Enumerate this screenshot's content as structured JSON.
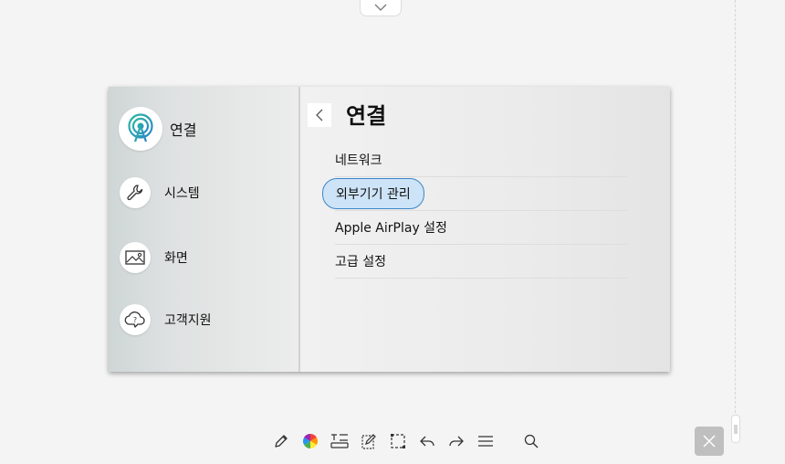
{
  "sidebar": {
    "items": [
      {
        "label": "연결",
        "icon": "antenna-icon",
        "active": true
      },
      {
        "label": "시스템",
        "icon": "wrench-icon",
        "active": false
      },
      {
        "label": "화면",
        "icon": "image-icon",
        "active": false
      },
      {
        "label": "고객지원",
        "icon": "cloud-help-icon",
        "active": false
      }
    ]
  },
  "main": {
    "title": "연결",
    "menu": [
      {
        "label": "네트워크",
        "focused": false
      },
      {
        "label": "외부기기 관리",
        "focused": true
      },
      {
        "label": "Apple AirPlay 설정",
        "focused": false
      },
      {
        "label": "고급 설정",
        "focused": false
      }
    ]
  },
  "colors": {
    "accent": "#3d86c9",
    "focus_fill": "#cde3f7",
    "antenna_gradient": [
      "#2bb8a4",
      "#2a86c9"
    ]
  },
  "toolbar": {
    "icons": [
      "pen-icon",
      "color-wheel-icon",
      "text-box-icon",
      "edit-note-icon",
      "select-area-icon",
      "undo-icon",
      "redo-icon",
      "menu-icon",
      "search-icon"
    ]
  }
}
